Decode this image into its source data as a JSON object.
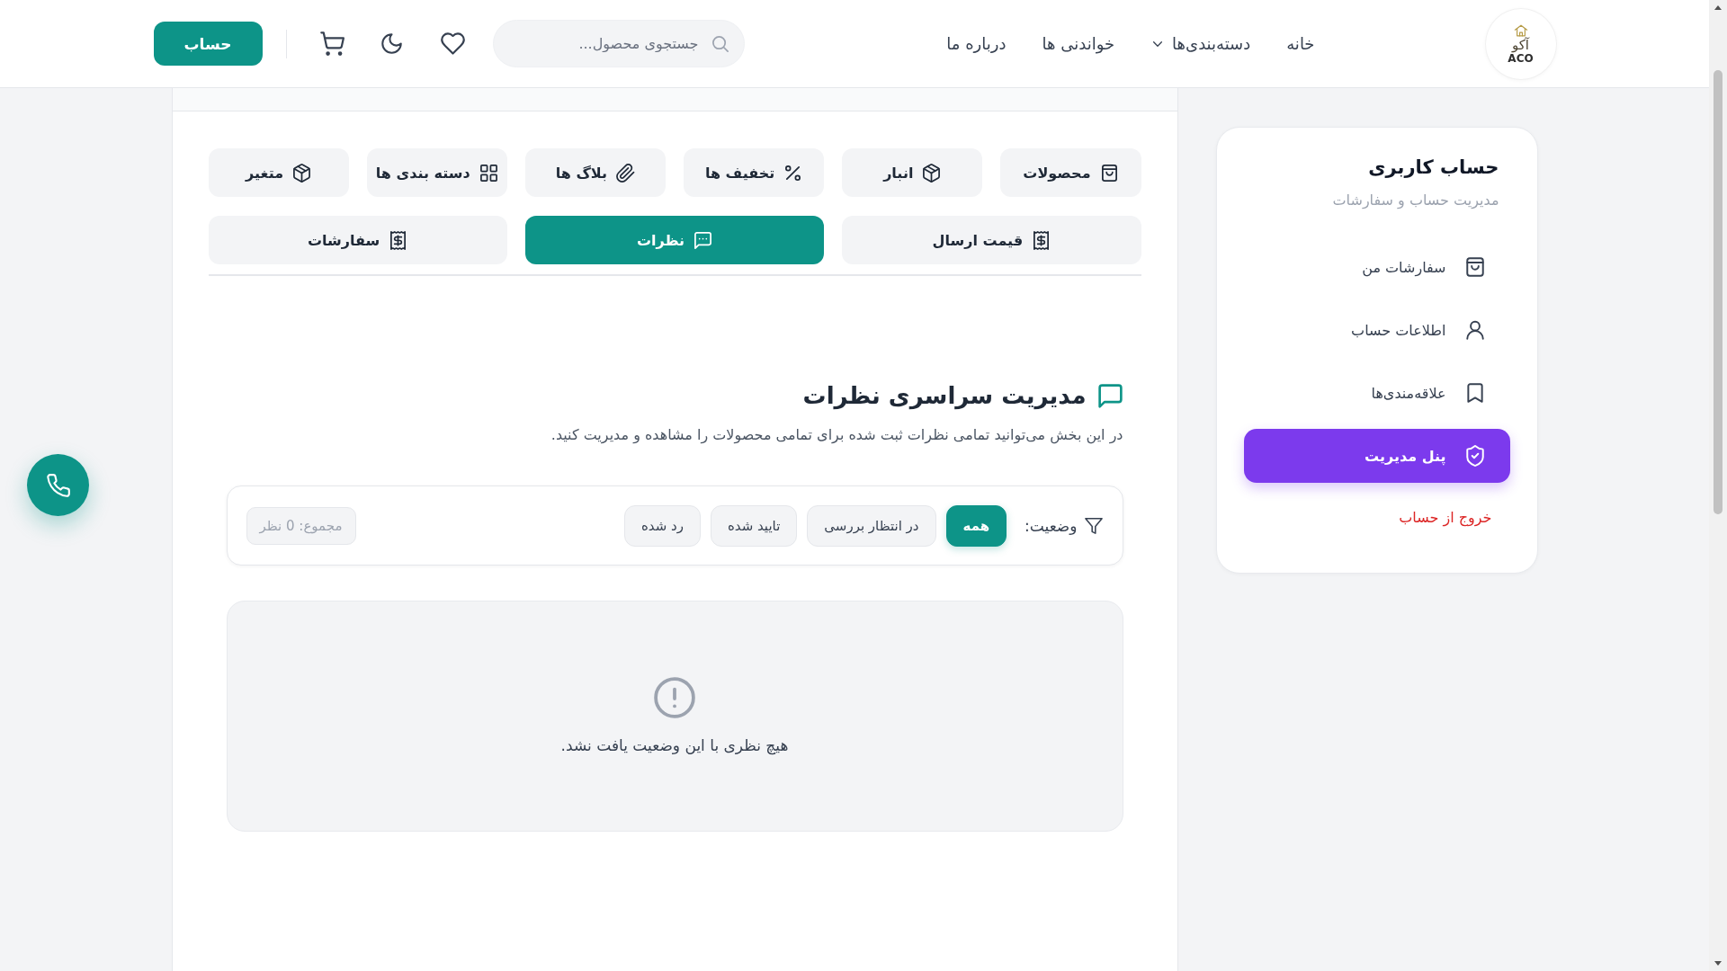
{
  "header": {
    "logo": {
      "name_fa": "آکو",
      "name_en": "ACO"
    },
    "nav": [
      {
        "label": "خانه",
        "kind": "link"
      },
      {
        "label": "دسته‌بندی‌ها",
        "kind": "dropdown"
      },
      {
        "label": "خواندنی ها",
        "kind": "link"
      },
      {
        "label": "درباره ما",
        "kind": "link"
      }
    ],
    "search": {
      "placeholder": "جستجوی محصول..."
    },
    "account_button": {
      "label": "حساب"
    }
  },
  "sidebar": {
    "title": "حساب کاربری",
    "subtitle": "مدیریت حساب و سفارشات",
    "items": [
      {
        "label": "سفارشات من",
        "selected": false
      },
      {
        "label": "اطلاعات حساب",
        "selected": false
      },
      {
        "label": "علاقه‌مندی‌ها",
        "selected": false
      },
      {
        "label": "پنل مدیریت",
        "selected": true
      }
    ],
    "logout": {
      "label": "خروج از حساب"
    }
  },
  "admin_tabs": [
    {
      "label": "محصولات",
      "selected": false
    },
    {
      "label": "انبار",
      "selected": false
    },
    {
      "label": "تخفیف ها",
      "selected": false
    },
    {
      "label": "بلاگ ها",
      "selected": false
    },
    {
      "label": "دسته بندی ها",
      "selected": false
    },
    {
      "label": "متغیر",
      "selected": false
    },
    {
      "label": "قیمت ارسال",
      "selected": false
    },
    {
      "label": "نظرات",
      "selected": true
    },
    {
      "label": "سفارشات",
      "selected": false
    }
  ],
  "section": {
    "title": "مدیریت سراسری نظرات",
    "description": "در این بخش می‌توانید تمامی نظرات ثبت شده برای تمامی محصولات را مشاهده و مدیریت کنید."
  },
  "filter": {
    "label": "وضعیت:",
    "options": [
      {
        "label": "همه",
        "selected": true
      },
      {
        "label": "در انتظار بررسی",
        "selected": false
      },
      {
        "label": "تایید شده",
        "selected": false
      },
      {
        "label": "رد شده",
        "selected": false
      }
    ],
    "total": "مجموع: 0 نظر"
  },
  "empty_state": {
    "message": "هیچ نظری با این وضعیت یافت نشد."
  }
}
